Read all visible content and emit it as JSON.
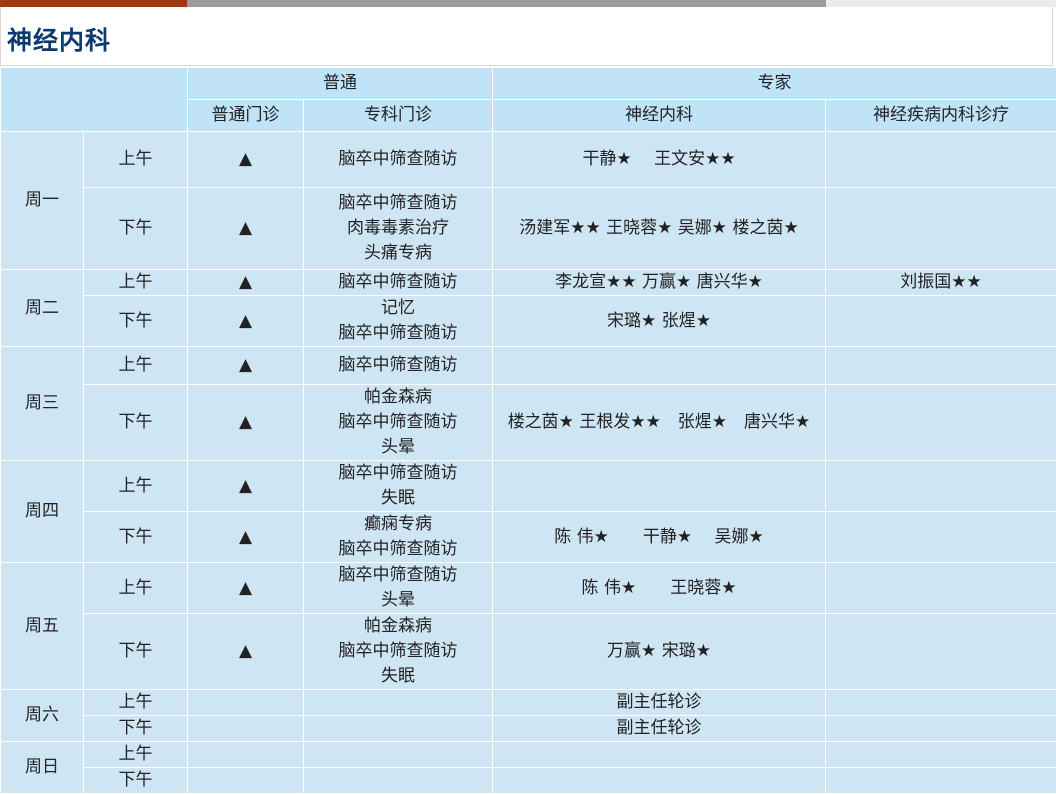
{
  "title": "神经内科",
  "header": {
    "group_general": "普通",
    "group_expert": "专家",
    "col_general_clinic": "普通门诊",
    "col_special_clinic": "专科门诊",
    "col_neuro": "神经内科",
    "col_neuro_disease": "神经疾病内科诊疗"
  },
  "days": [
    {
      "day": "周一",
      "rows": [
        {
          "period": "上午",
          "general": "▲",
          "special": [
            "脑卒中筛查随访"
          ],
          "neuro": "干静★　 王文安★★",
          "disease": ""
        },
        {
          "period": "下午",
          "general": "▲",
          "special": [
            "脑卒中筛查随访",
            "肉毒毒素治疗",
            "头痛专病"
          ],
          "neuro": "汤建军★★ 王晓蓉★ 吴娜★ 楼之茵★",
          "disease": ""
        }
      ]
    },
    {
      "day": "周二",
      "rows": [
        {
          "period": "上午",
          "general": "▲",
          "special": [
            "脑卒中筛查随访"
          ],
          "neuro": "李龙宣★★ 万赢★ 唐兴华★",
          "disease": "刘振国★★"
        },
        {
          "period": "下午",
          "general": "▲",
          "special": [
            "记忆",
            "脑卒中筛查随访"
          ],
          "neuro": "宋璐★ 张煋★",
          "disease": ""
        }
      ]
    },
    {
      "day": "周三",
      "rows": [
        {
          "period": "上午",
          "general": "▲",
          "special": [
            "脑卒中筛查随访"
          ],
          "neuro": "",
          "disease": ""
        },
        {
          "period": "下午",
          "general": "▲",
          "special": [
            "帕金森病",
            "脑卒中筛查随访",
            "头晕"
          ],
          "neuro": "楼之茵★ 王根发★★　张煋★　唐兴华★",
          "disease": ""
        }
      ]
    },
    {
      "day": "周四",
      "rows": [
        {
          "period": "上午",
          "general": "▲",
          "special": [
            "脑卒中筛查随访",
            "失眠"
          ],
          "neuro": "",
          "disease": ""
        },
        {
          "period": "下午",
          "general": "▲",
          "special": [
            "癫痫专病",
            "脑卒中筛查随访"
          ],
          "neuro": "陈 伟★　　干静★　 吴娜★",
          "disease": ""
        }
      ]
    },
    {
      "day": "周五",
      "rows": [
        {
          "period": "上午",
          "general": "▲",
          "special": [
            "脑卒中筛查随访",
            "头晕"
          ],
          "neuro": "陈 伟★　　王晓蓉★",
          "disease": ""
        },
        {
          "period": "下午",
          "general": "▲",
          "special": [
            "帕金森病",
            "脑卒中筛查随访",
            "失眠"
          ],
          "neuro": "万赢★ 宋璐★",
          "disease": ""
        }
      ]
    },
    {
      "day": "周六",
      "rows": [
        {
          "period": "上午",
          "general": "",
          "special": [],
          "neuro": "副主任轮诊",
          "disease": ""
        },
        {
          "period": "下午",
          "general": "",
          "special": [],
          "neuro": "副主任轮诊",
          "disease": ""
        }
      ]
    },
    {
      "day": "周日",
      "rows": [
        {
          "period": "上午",
          "general": "",
          "special": [],
          "neuro": "",
          "disease": ""
        },
        {
          "period": "下午",
          "general": "",
          "special": [],
          "neuro": "",
          "disease": ""
        }
      ]
    }
  ]
}
